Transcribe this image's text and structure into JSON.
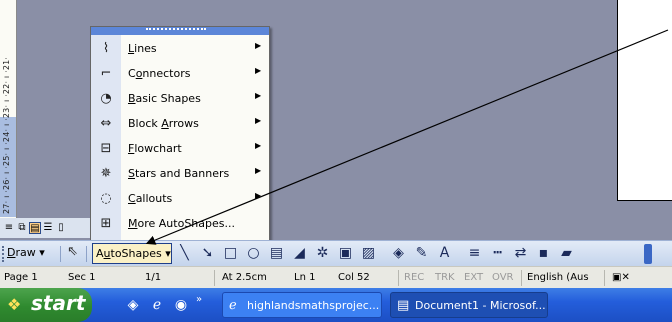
{
  "ruler": {
    "text": "27· ı ·26· ı ·25· ı ·24· ı ·23· ı ·22· ı ·21·"
  },
  "menu": {
    "items": [
      {
        "icon": "lines-icon",
        "glyph": "⌇",
        "mnemonic": "L",
        "rest": "ines",
        "submenu": true
      },
      {
        "icon": "connectors-icon",
        "glyph": "⌐",
        "pre": "C",
        "mnemonic": "o",
        "rest": "nnectors",
        "submenu": true
      },
      {
        "icon": "basic-shapes-icon",
        "glyph": "◔",
        "mnemonic": "B",
        "rest": "asic Shapes",
        "submenu": true
      },
      {
        "icon": "block-arrows-icon",
        "glyph": "⇔",
        "pre": "Block ",
        "mnemonic": "A",
        "rest": "rrows",
        "submenu": true
      },
      {
        "icon": "flowchart-icon",
        "glyph": "⊟",
        "mnemonic": "F",
        "rest": "lowchart",
        "submenu": true
      },
      {
        "icon": "stars-banners-icon",
        "glyph": "✵",
        "mnemonic": "S",
        "rest": "tars and Banners",
        "submenu": true
      },
      {
        "icon": "callouts-icon",
        "glyph": "◌",
        "mnemonic": "C",
        "rest": "allouts",
        "submenu": true
      },
      {
        "icon": "more-autoshapes-icon",
        "glyph": "⊞",
        "mnemonic": "M",
        "rest": "ore AutoShapes...",
        "submenu": false
      }
    ]
  },
  "drawbar": {
    "draw_mnemonic": "D",
    "draw_rest": "raw ▾",
    "autoshapes_pre": "A",
    "autoshapes_mnemonic": "u",
    "autoshapes_rest": "toShapes ▾",
    "tools": [
      {
        "name": "line-tool-icon",
        "glyph": "╲"
      },
      {
        "name": "arrow-tool-icon",
        "glyph": "➘"
      },
      {
        "name": "rectangle-tool-icon",
        "glyph": "□"
      },
      {
        "name": "oval-tool-icon",
        "glyph": "○"
      },
      {
        "name": "textbox-tool-icon",
        "glyph": "▤"
      },
      {
        "name": "wordart-icon",
        "glyph": "◢"
      },
      {
        "name": "diagram-icon",
        "glyph": "✲"
      },
      {
        "name": "clipart-icon",
        "glyph": "▣"
      },
      {
        "name": "picture-icon",
        "glyph": "▨"
      },
      {
        "name": "fill-color-icon",
        "glyph": "◈"
      },
      {
        "name": "line-color-icon",
        "glyph": "✎"
      },
      {
        "name": "font-color-icon",
        "glyph": "A"
      },
      {
        "name": "line-style-icon",
        "glyph": "≡"
      },
      {
        "name": "dash-style-icon",
        "glyph": "┅"
      },
      {
        "name": "arrow-style-icon",
        "glyph": "⇄"
      },
      {
        "name": "shadow-style-icon",
        "glyph": "▪"
      },
      {
        "name": "3d-style-icon",
        "glyph": "▰"
      }
    ]
  },
  "status": {
    "page": "Page 1",
    "sec": "Sec 1",
    "pages": "1/1",
    "at": "At 2.5cm",
    "ln": "Ln 1",
    "col": "Col 52",
    "rec": "REC",
    "trk": "TRK",
    "ext": "EXT",
    "ovr": "OVR",
    "language": "English (Aus"
  },
  "taskbar": {
    "start_label": "start",
    "tasks": [
      {
        "label": "highlandsmathsprojec..."
      },
      {
        "label": "Document1 - Microsof..."
      }
    ]
  },
  "colors": {
    "menu_header": "#5c86d8",
    "taskbar": "#245edb",
    "start": "#2f8a2f",
    "workspace": "#8a8fa6"
  }
}
